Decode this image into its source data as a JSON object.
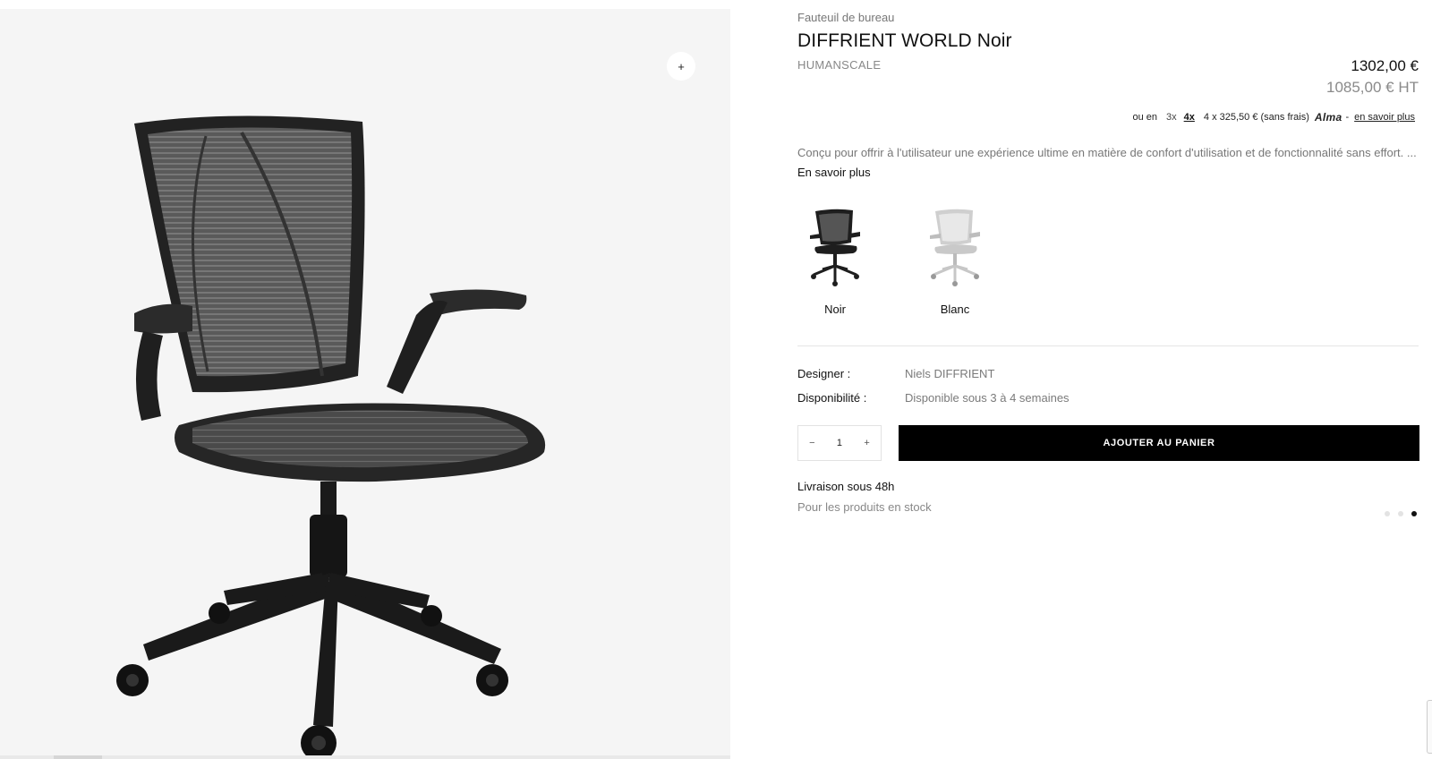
{
  "gallery": {
    "zoom_label": "+",
    "image_icon": "office-chair-black"
  },
  "product": {
    "category": "Fauteuil de bureau",
    "title": "DIFFRIENT WORLD Noir",
    "brand": "HUMANSCALE",
    "price": "1302,00 €",
    "price_ht": "1085,00 € HT"
  },
  "financing": {
    "prefix": "ou en",
    "options": [
      "3x",
      "4x"
    ],
    "selected": "4x",
    "amount": "4 x 325,50 € (sans frais)",
    "provider": "Alma",
    "separator": "-",
    "link": "en savoir plus"
  },
  "description": {
    "text": "Conçu pour offrir à l'utilisateur une expérience ultime en matière de confort d'utilisation et de fonctionnalité sans effort. ...",
    "more": "En savoir plus"
  },
  "variants": [
    {
      "label": "Noir",
      "color": "#1e1e1e",
      "selected": true
    },
    {
      "label": "Blanc",
      "color": "#d4d4d4",
      "selected": false
    }
  ],
  "specs": [
    {
      "key": "Designer :",
      "value": "Niels DIFFRIENT"
    },
    {
      "key": "Disponibilité :",
      "value": "Disponible sous 3 à 4 semaines"
    }
  ],
  "cart": {
    "minus": "−",
    "quantity": "1",
    "plus": "+",
    "add_label": "AJOUTER AU PANIER"
  },
  "shipping": {
    "title": "Livraison sous 48h",
    "subtitle": "Pour les produits en stock"
  },
  "carousel": {
    "total": 3,
    "active_index": 2
  },
  "colors": {
    "accent": "#000000",
    "muted": "#777777"
  }
}
